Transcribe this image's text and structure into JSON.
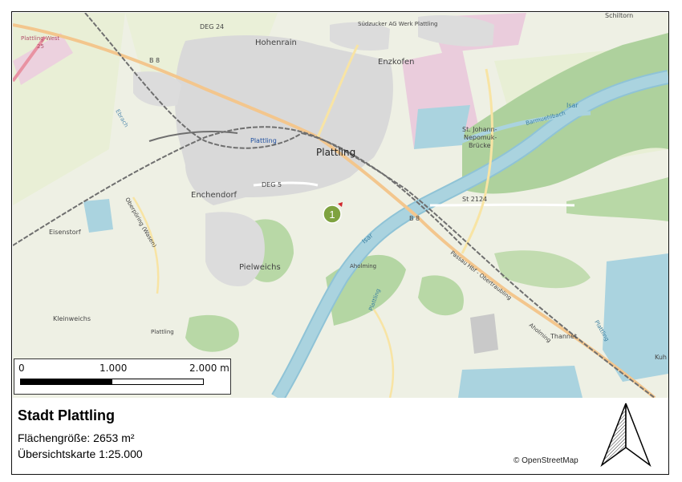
{
  "map": {
    "labels": {
      "deg24": "DEG 24",
      "hohenrain": "Hohenrain",
      "suedzucker": "Südzucker AG Werk Plattling",
      "enzkofen": "Enzkofen",
      "schiltorn": "Schiltorn",
      "b8_top": "B 8",
      "plattling_west": "Plattling-West",
      "plattling_west_num": "25",
      "ebrach": "Ebrach",
      "plattling_station": "Plattling",
      "plattling_city": "Plattling",
      "barmuhlbach": "Barmuehlbach",
      "st_johann": "St. Johann-",
      "nepomuk": "Nepomuk-",
      "bruecke": "Brücke",
      "isar_top": "Isar",
      "enchendorf": "Enchendorf",
      "deg5": "DEG 5",
      "st2124": "St 2124",
      "b8_mid": "B 8",
      "isar_mid": "Isar",
      "eisenstorf": "Eisenstorf",
      "oberpoering": "Oberpöring (Wasen)",
      "pielweichs": "Pielweichs",
      "aholming1": "Aholming",
      "passau": "Passau Hbf - Obertraubling",
      "kleinweichs": "Kleinweichs",
      "plattling_small1": "Plattling",
      "plattling_small2": "Plattling",
      "plattling_small3": "Plattling",
      "aholming2": "Aholming",
      "thannet": "Thannet",
      "kuh": "Kuh"
    },
    "marker": "1",
    "colors": {
      "background": "#eef0e4",
      "forest": "#aed19d",
      "water": "#aad3df",
      "river": "#8fc3d6",
      "residential": "#d9d9d9",
      "road_major": "#f3c68d",
      "railway": "#6f6f6f",
      "marker": "#7ea23f"
    }
  },
  "scalebar": {
    "zero": "0",
    "mid": "1.000",
    "end": "2.000 m"
  },
  "legend": {
    "title": "Stadt Plattling",
    "area": "Flächengröße: 2653 m²",
    "overview": "Übersichtskarte 1:25.000",
    "attribution": "© OpenStreetMap"
  },
  "north_arrow": "north-arrow-icon"
}
